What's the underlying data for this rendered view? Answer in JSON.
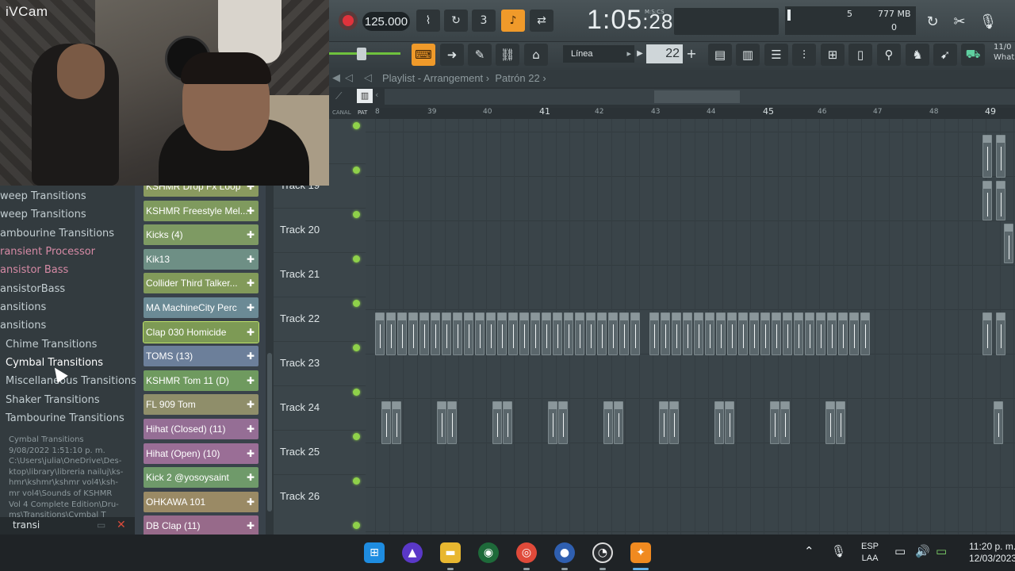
{
  "webcam": {
    "label": "iVCam"
  },
  "toolbar": {
    "tempo": "125.000",
    "time_main": "1:05",
    "time_small": ":28",
    "time_unit": "M:S:CS",
    "cpu_voices": "5",
    "memory": "777 MB",
    "cpu_zero": "0",
    "snap": "Línea",
    "pattern_number": "22",
    "corner_text_1": "11/0",
    "corner_text_2": "What"
  },
  "browser": {
    "items": [
      {
        "label": "weep Transitions",
        "style": "normal"
      },
      {
        "label": "weep Transitions",
        "style": "normal"
      },
      {
        "label": "ambourine Transitions",
        "style": "normal"
      },
      {
        "label": "ransient Processor",
        "style": "pink"
      },
      {
        "label": "ansistor Bass",
        "style": "pink"
      },
      {
        "label": "ansistorBass",
        "style": "normal"
      },
      {
        "label": "ansitions",
        "style": "normal"
      },
      {
        "label": "ansitions",
        "style": "normal"
      },
      {
        "label": "Chime Transitions",
        "style": "sub"
      },
      {
        "label": "Cymbal Transitions",
        "style": "sub-sel"
      },
      {
        "label": "Miscellaneous Transitions",
        "style": "sub"
      },
      {
        "label": "Shaker Transitions",
        "style": "sub"
      },
      {
        "label": "Tambourine Transitions",
        "style": "sub"
      }
    ],
    "info": [
      "Cymbal Transitions",
      "9/08/2022 1:51:10 p. m.",
      "C:\\Users\\julia\\OneDrive\\Des-",
      "ktop\\library\\libreria nailuj\\ks-",
      "hmr\\kshmr\\kshmr vol4\\ksh-",
      "mr vol4\\Sounds of KSHMR",
      "Vol 4 Complete Edition\\Dru-",
      "ms\\Transitions\\Cymbal T"
    ],
    "search": "transi"
  },
  "channels": [
    {
      "label": "KSHMR Drop Fx Loop",
      "color": "#8a9a5f"
    },
    {
      "label": "KSHMR Freestyle Mel...",
      "color": "#7f9a5e"
    },
    {
      "label": "Kicks (4)",
      "color": "#7e9a63"
    },
    {
      "label": "Kik13",
      "color": "#6e8f85"
    },
    {
      "label": "Collider Third Talker...",
      "color": "#829a5a"
    },
    {
      "label": "MA MachineCity Perc",
      "color": "#6b8a95"
    },
    {
      "label": "Clap 030 Homicide",
      "color": "#7d9a55"
    },
    {
      "label": "TOMS (13)",
      "color": "#6c7f9a"
    },
    {
      "label": "KSHMR Tom 11 (D)",
      "color": "#6f9a5f"
    },
    {
      "label": "FL 909 Tom",
      "color": "#8f8e6a"
    },
    {
      "label": "Hihat (Closed) (11)",
      "color": "#956e95"
    },
    {
      "label": "Hihat (Open) (10)",
      "color": "#9a6e96"
    },
    {
      "label": "Kick 2 @yosoysaint",
      "color": "#6f9a6a"
    },
    {
      "label": "OHKAWA 101",
      "color": "#9a8a65"
    },
    {
      "label": "DB Clap (11)",
      "color": "#976a8a"
    }
  ],
  "playlist": {
    "title": "Playlist - Arrangement",
    "pattern": "Patrón 22",
    "canal_label": "CANAL",
    "pat_label": "PAT",
    "bars": [
      {
        "n": "8",
        "big": false
      },
      {
        "n": "39",
        "big": false
      },
      {
        "n": "40",
        "big": false
      },
      {
        "n": "41",
        "big": true
      },
      {
        "n": "42",
        "big": false
      },
      {
        "n": "43",
        "big": false
      },
      {
        "n": "44",
        "big": false
      },
      {
        "n": "45",
        "big": true
      },
      {
        "n": "46",
        "big": false
      },
      {
        "n": "47",
        "big": false
      },
      {
        "n": "48",
        "big": false
      },
      {
        "n": "49",
        "big": true
      }
    ],
    "tracks": [
      {
        "label": "Track 19"
      },
      {
        "label": "Track 20"
      },
      {
        "label": "Track 21"
      },
      {
        "label": "Track 22"
      },
      {
        "label": "Track 23"
      },
      {
        "label": "Track 24"
      },
      {
        "label": "Track 25"
      },
      {
        "label": "Track 26"
      }
    ]
  },
  "taskbar": {
    "lang_1": "ESP",
    "lang_2": "LAA",
    "time": "11:20 p. m.",
    "date": "12/03/2023"
  }
}
